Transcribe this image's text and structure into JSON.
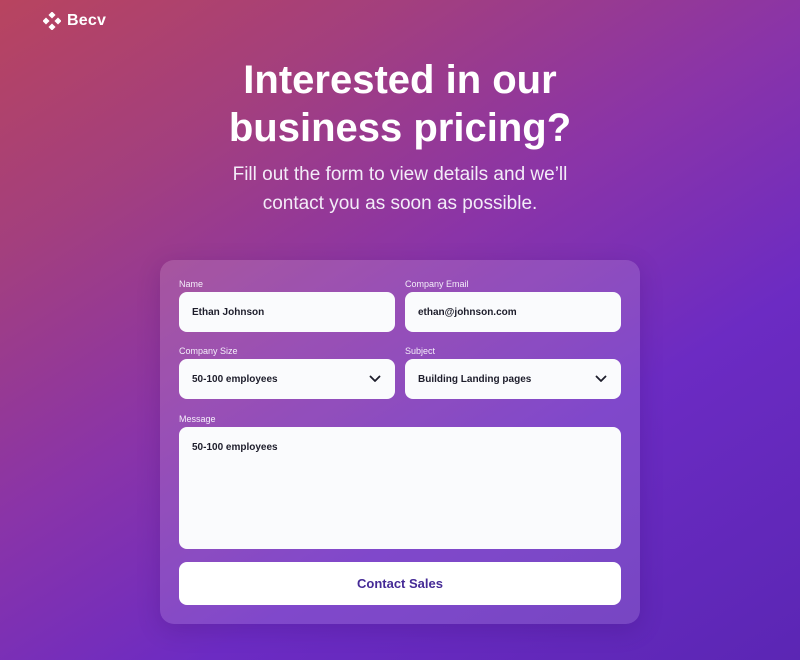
{
  "brand": {
    "name": "Becv",
    "logo_icon": "diamond-grid-icon"
  },
  "hero": {
    "title_lines": [
      "Interested in our",
      "business pricing?"
    ],
    "subtitle_lines": [
      "Fill out the form to view details and we’ll",
      "contact you as soon as possible."
    ]
  },
  "form": {
    "name": {
      "label": "Name",
      "value": "Ethan Johnson"
    },
    "email": {
      "label": "Company Email",
      "value": "ethan@johnson.com"
    },
    "company_size": {
      "label": "Company Size",
      "value": "50-100 employees",
      "icon": "chevron-down-icon"
    },
    "subject": {
      "label": "Subject",
      "value": "Building Landing pages",
      "icon": "chevron-down-icon"
    },
    "message": {
      "label": "Message",
      "value": "50-100 employees"
    },
    "submit_label": "Contact Sales"
  },
  "colors": {
    "gradient_start": "#b8445f",
    "gradient_mid": "#8a34a8",
    "gradient_end": "#5b26b4",
    "button_text": "#452a96",
    "field_bg": "#fafbfd"
  }
}
